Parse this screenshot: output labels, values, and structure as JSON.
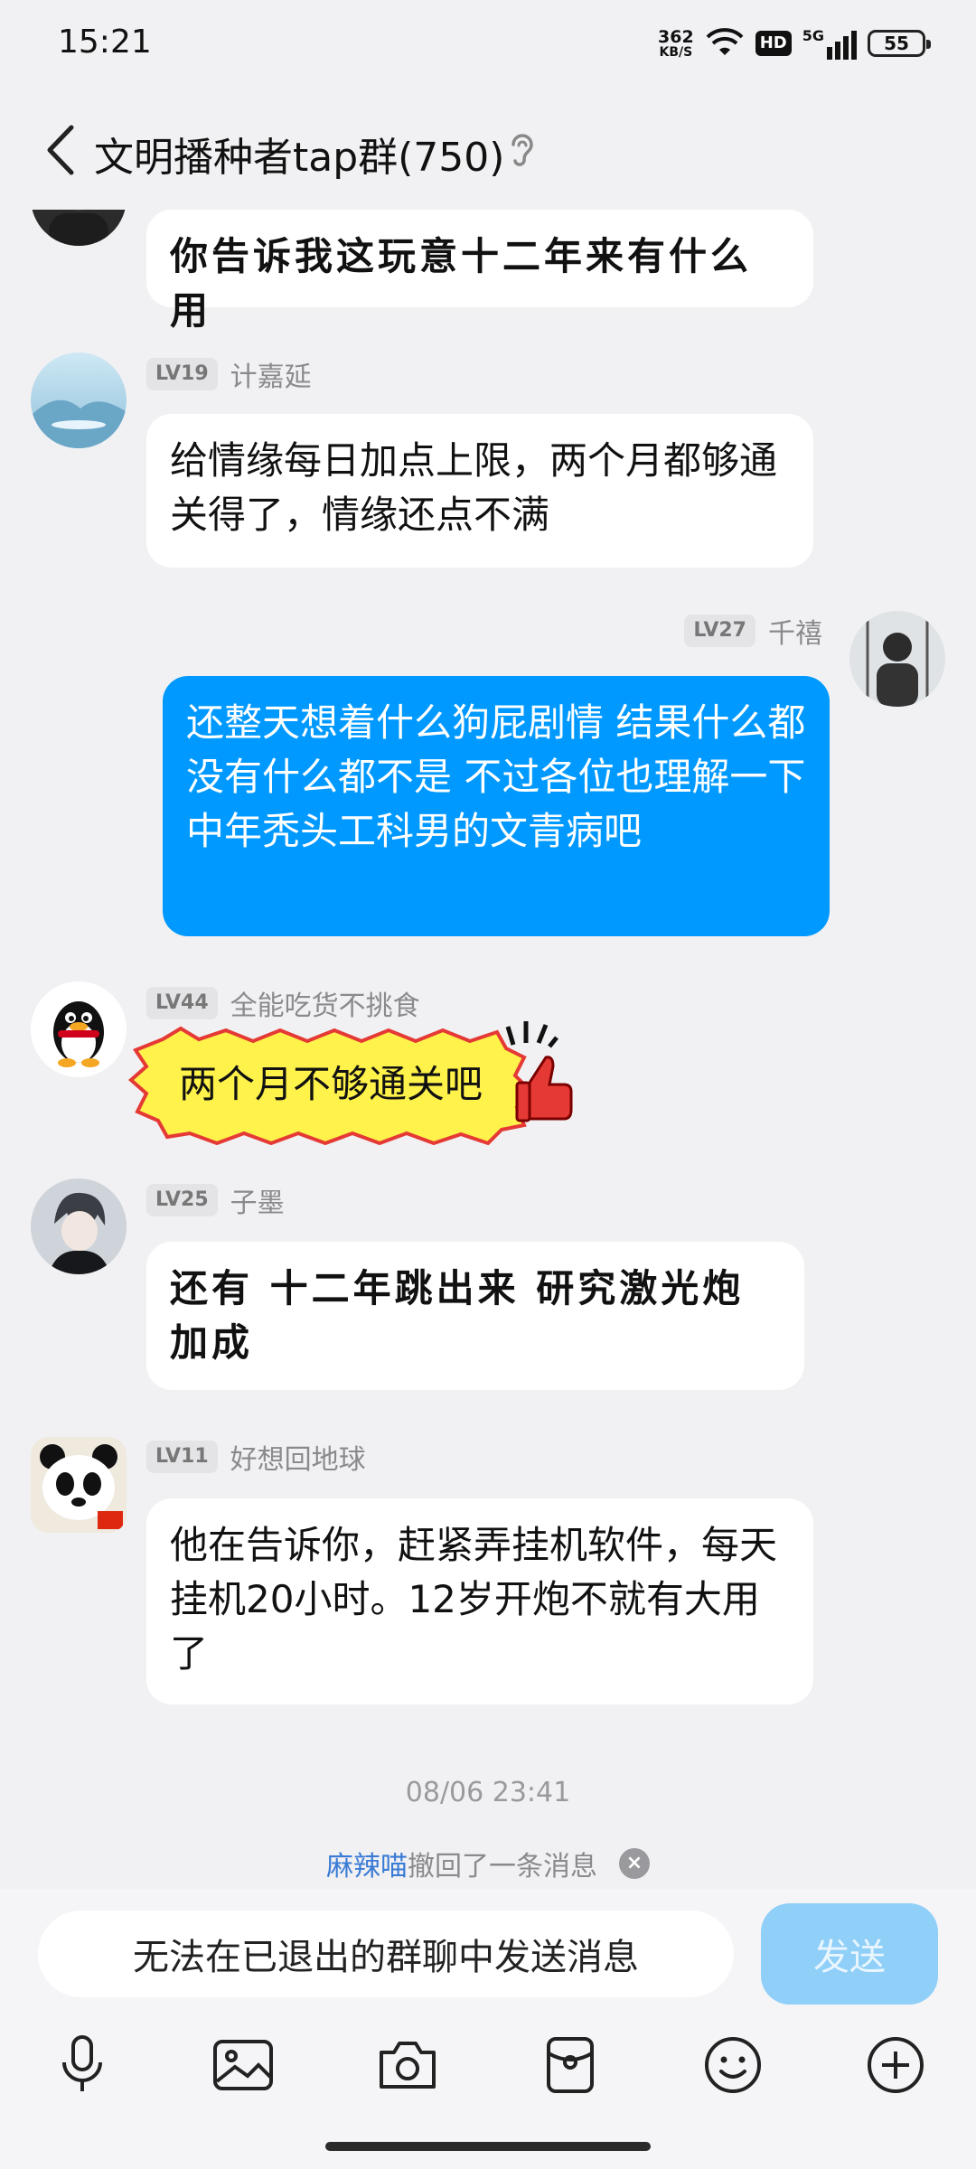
{
  "status_bar": {
    "time": "15:21",
    "net_speed_value": "362",
    "net_speed_unit": "KB/S",
    "hd": "HD",
    "signal": "5G",
    "battery": "55"
  },
  "header": {
    "title": "文明播种者tap群(750)"
  },
  "messages": [
    {
      "sender": "",
      "level": "",
      "text": "你告诉我这玩意十二年来有什么用",
      "avatar_icon": "dark-avatar"
    },
    {
      "sender": "计嘉延",
      "level": "LV19",
      "text": "给情缘每日加点上限，两个月都够通关得了，情缘还点不满",
      "avatar_icon": "landscape-avatar"
    },
    {
      "sender": "千禧",
      "level": "LV27",
      "text": "还整天想着什么狗屁剧情 结果什么都没有什么都不是 不过各位也理解一下中年秃头工科男的文青病吧",
      "avatar_icon": "person-avatar"
    },
    {
      "sender": "全能吃货不挑食",
      "level": "LV44",
      "text": "两个月不够通关吧",
      "avatar_icon": "qq-penguin-avatar"
    },
    {
      "sender": "子墨",
      "level": "LV25",
      "text": "还有 十二年跳出来 研究激光炮加成",
      "avatar_icon": "anime-avatar"
    },
    {
      "sender": "好想回地球",
      "level": "LV11",
      "text": "他在告诉你，赶紧弄挂机软件，每天挂机20小时。12岁开炮不就有大用了",
      "avatar_icon": "panda-avatar"
    }
  ],
  "timestamp": "08/06 23:41",
  "recall": {
    "name": "麻辣喵",
    "text": "撤回了一条消息"
  },
  "input": {
    "disabled_text": "无法在已退出的群聊中发送消息",
    "send_label": "发送"
  },
  "colors": {
    "self_bubble": "#0099ff",
    "send_disabled": "#8fcff8",
    "recall_name": "#3a7bd5"
  }
}
